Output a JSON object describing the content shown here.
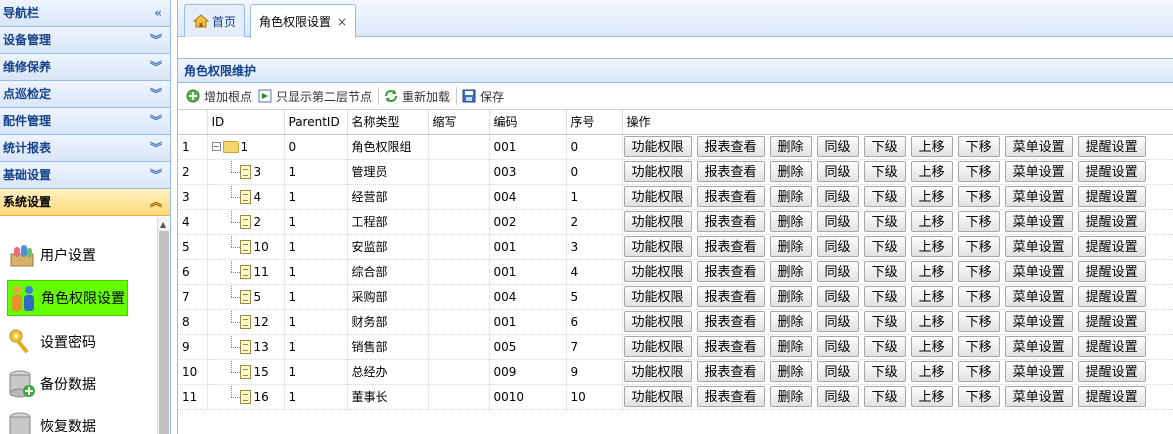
{
  "sidebar": {
    "header_title": "导航栏",
    "sections": [
      {
        "label": "设备管理"
      },
      {
        "label": "维修保养"
      },
      {
        "label": "点巡检定"
      },
      {
        "label": "配件管理"
      },
      {
        "label": "统计报表"
      },
      {
        "label": "基础设置"
      },
      {
        "label": "系统设置"
      }
    ],
    "links": [
      {
        "label": "用户设置",
        "icon": "users-icon"
      },
      {
        "label": "角色权限设置",
        "icon": "role-people-icon"
      },
      {
        "label": "设置密码",
        "icon": "key-icon"
      },
      {
        "label": "备份数据",
        "icon": "database-backup-icon"
      },
      {
        "label": "恢复数据",
        "icon": "database-restore-icon"
      }
    ]
  },
  "tabs": [
    {
      "label": "首页"
    },
    {
      "label": "角色权限设置",
      "close": "×"
    }
  ],
  "panel": {
    "title": "角色权限维护"
  },
  "toolbar": {
    "add_root": "增加根点",
    "show_second": "只显示第二层节点",
    "reload": "重新加载",
    "save": "保存"
  },
  "columns": [
    "ID",
    "ParentID",
    "名称类型",
    "缩写",
    "编码",
    "序号",
    "操作"
  ],
  "ops": [
    "功能权限",
    "报表查看",
    "删除",
    "同级",
    "下级",
    "上移",
    "下移",
    "菜单设置",
    "提醒设置"
  ],
  "rows": [
    {
      "n": "1",
      "id": "1",
      "parent": "0",
      "name": "角色权限组",
      "abbr": "",
      "code": "001",
      "seq": "0"
    },
    {
      "n": "2",
      "id": "3",
      "parent": "1",
      "name": "管理员",
      "abbr": "",
      "code": "003",
      "seq": "0"
    },
    {
      "n": "3",
      "id": "4",
      "parent": "1",
      "name": "经营部",
      "abbr": "",
      "code": "004",
      "seq": "1"
    },
    {
      "n": "4",
      "id": "2",
      "parent": "1",
      "name": "工程部",
      "abbr": "",
      "code": "002",
      "seq": "2"
    },
    {
      "n": "5",
      "id": "10",
      "parent": "1",
      "name": "安监部",
      "abbr": "",
      "code": "001",
      "seq": "3"
    },
    {
      "n": "6",
      "id": "11",
      "parent": "1",
      "name": "综合部",
      "abbr": "",
      "code": "001",
      "seq": "4"
    },
    {
      "n": "7",
      "id": "5",
      "parent": "1",
      "name": "采购部",
      "abbr": "",
      "code": "004",
      "seq": "5"
    },
    {
      "n": "8",
      "id": "12",
      "parent": "1",
      "name": "财务部",
      "abbr": "",
      "code": "001",
      "seq": "6"
    },
    {
      "n": "9",
      "id": "13",
      "parent": "1",
      "name": "销售部",
      "abbr": "",
      "code": "005",
      "seq": "7"
    },
    {
      "n": "10",
      "id": "15",
      "parent": "1",
      "name": "总经办",
      "abbr": "",
      "code": "009",
      "seq": "9"
    },
    {
      "n": "11",
      "id": "16",
      "parent": "1",
      "name": "董事长",
      "abbr": "",
      "code": "0010",
      "seq": "10"
    }
  ]
}
